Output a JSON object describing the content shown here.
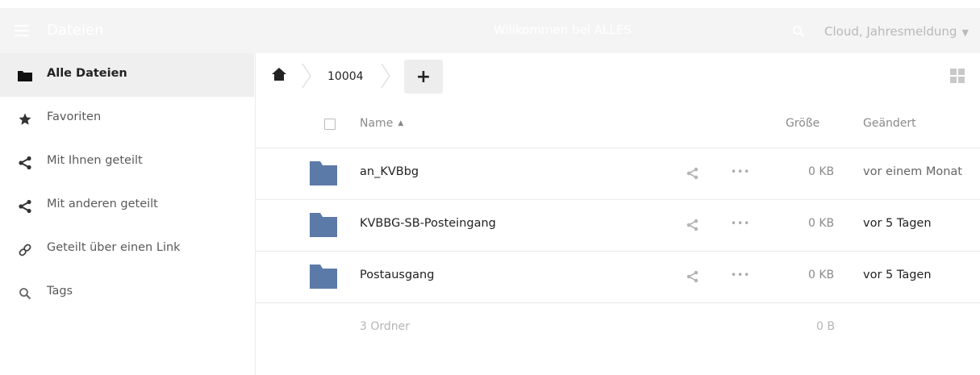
{
  "header": {
    "app_title": "Dateien",
    "center_title": "Willkommen bei ALLES",
    "user_menu": "Cloud, Jahresmeldung",
    "caret": "▼"
  },
  "sidebar": {
    "items": [
      {
        "label": "Alle Dateien",
        "icon": "folder-icon",
        "active": true
      },
      {
        "label": "Favoriten",
        "icon": "star-icon"
      },
      {
        "label": "Mit Ihnen geteilt",
        "icon": "share-icon"
      },
      {
        "label": "Mit anderen geteilt",
        "icon": "share-icon"
      },
      {
        "label": "Geteilt über einen Link",
        "icon": "link-icon"
      },
      {
        "label": "Tags",
        "icon": "search-icon"
      }
    ]
  },
  "breadcrumb": {
    "home_icon": "home-icon",
    "folder": "10004",
    "add_label": "+"
  },
  "file_list": {
    "columns": {
      "name": "Name",
      "size": "Größe",
      "modified": "Geändert"
    },
    "sort_indicator": "▲",
    "more_label": "•••",
    "rows": [
      {
        "name": "an_KVBbg",
        "size": "0 KB",
        "modified": "vor einem Monat"
      },
      {
        "name": "KVBBG-SB-Posteingang",
        "size": "0 KB",
        "modified": "vor 5 Tagen"
      },
      {
        "name": "Postausgang",
        "size": "0 KB",
        "modified": "vor 5 Tagen"
      }
    ],
    "summary": {
      "count": "3 Ordner",
      "total": "0 B"
    }
  },
  "colors": {
    "folder": "#5b7aa8",
    "header_bg": "#f4f4f4",
    "active_item_bg": "#efefef"
  }
}
